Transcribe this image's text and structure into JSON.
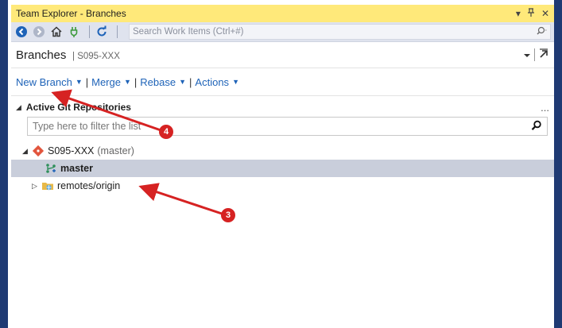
{
  "window": {
    "title": "Team Explorer - Branches",
    "ctrl_dropdown": "▾",
    "ctrl_pin": "♇",
    "ctrl_close": "✕"
  },
  "toolbar": {
    "search_placeholder": "Search Work Items (Ctrl+#)",
    "icons": [
      "back-icon",
      "forward-icon",
      "home-icon",
      "plug-icon",
      "refresh-icon"
    ]
  },
  "header": {
    "title": "Branches",
    "subtitle": "S095-XXX"
  },
  "actions": {
    "new_branch": "New Branch",
    "merge": "Merge",
    "rebase": "Rebase",
    "actions": "Actions"
  },
  "section": {
    "title": "Active Git Repositories",
    "more": "..."
  },
  "filter": {
    "placeholder": "Type here to filter the list"
  },
  "tree": {
    "repo_name": "S095-XXX",
    "repo_branch": "(master)",
    "branch": "master",
    "remotes": "remotes/origin"
  },
  "annotations": [
    {
      "number": "4",
      "color": "#d62222"
    },
    {
      "number": "3",
      "color": "#d62222"
    }
  ],
  "colors": {
    "title_bar": "#ffe97a",
    "frame": "#1f3a73",
    "link": "#1e63b8",
    "selected_row": "#c9cedb",
    "annotation_red": "#d62222"
  }
}
